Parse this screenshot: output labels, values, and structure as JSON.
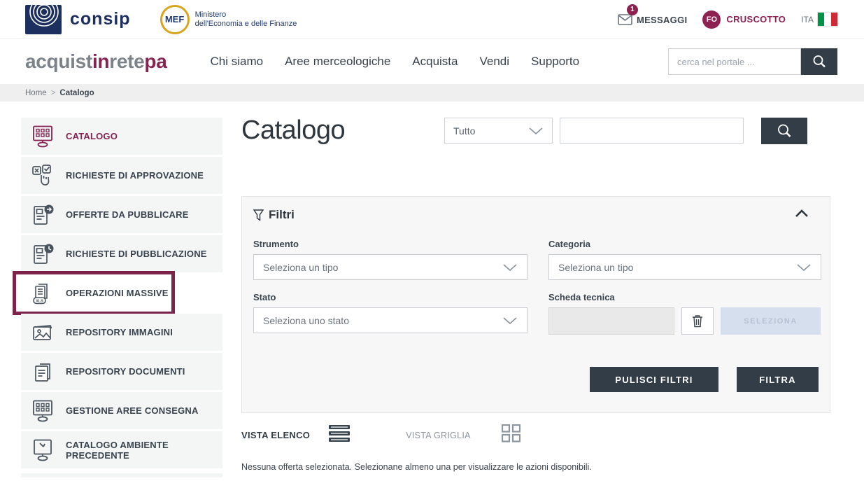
{
  "topbar": {
    "consip_label": "consip",
    "mef_acronym": "MEF",
    "mef_line1": "Ministero",
    "mef_line2": "dell'Economia e delle Finanze",
    "messages_label": "MESSAGGI",
    "messages_badge": "1",
    "user_initials": "FO",
    "dashboard_label": "CRUSCOTTO",
    "language_label": "ITA"
  },
  "nav": {
    "logo_part1": "acquist",
    "logo_part2": "in",
    "logo_part3": "rete",
    "logo_part4": "pa",
    "items": [
      "Chi siamo",
      "Aree merceologiche",
      "Acquista",
      "Vendi",
      "Supporto"
    ],
    "search_placeholder": "cerca nel portale ..."
  },
  "breadcrumb": {
    "home": "Home",
    "separator": ">",
    "current": "Catalogo"
  },
  "sidebar": {
    "items": [
      {
        "label": "CATALOGO",
        "icon": "catalog-monitor-icon",
        "active": true
      },
      {
        "label": "RICHIESTE DI APPROVAZIONE",
        "icon": "approval-checkboxes-icon"
      },
      {
        "label": "OFFERTE DA PUBBLICARE",
        "icon": "document-arrow-icon"
      },
      {
        "label": "RICHIESTE DI PUBBLICAZIONE",
        "icon": "document-clock-icon"
      },
      {
        "label": "OPERAZIONI MASSIVE",
        "icon": "xls-document-icon",
        "highlighted": true
      },
      {
        "label": "REPOSITORY IMMAGINI",
        "icon": "images-icon"
      },
      {
        "label": "REPOSITORY DOCUMENTI",
        "icon": "documents-stack-icon"
      },
      {
        "label": "GESTIONE AREE CONSEGNA",
        "icon": "grid-monitor-icon"
      },
      {
        "label": "CATALOGO AMBIENTE PRECEDENTE",
        "icon": "monitor-cursor-icon"
      }
    ],
    "xls_tag": "XLS"
  },
  "main": {
    "title": "Catalogo",
    "scope_select_value": "Tutto",
    "filters": {
      "title": "Filtri",
      "strumento_label": "Strumento",
      "strumento_value": "Seleziona un tipo",
      "categoria_label": "Categoria",
      "categoria_value": "Seleziona un tipo",
      "stato_label": "Stato",
      "stato_value": "Seleziona uno stato",
      "scheda_label": "Scheda tecnica",
      "seleziona_button": "SELEZIONA",
      "clear_button": "PULISCI FILTRI",
      "apply_button": "FILTRA"
    },
    "views": {
      "list_label": "VISTA ELENCO",
      "grid_label": "VISTA GRIGLIA"
    },
    "status_message": "Nessuna offerta selezionata. Selezionane almeno una per visualizzare le azioni disponibili."
  },
  "colors": {
    "brand_maroon": "#862352",
    "highlight_box": "#7d2248",
    "dark_button": "#333d47",
    "panel_bg": "#f7f7f8",
    "sidebar_item_bg": "#f4f5f5",
    "flag_green": "#009246",
    "flag_red": "#ce2b37"
  }
}
